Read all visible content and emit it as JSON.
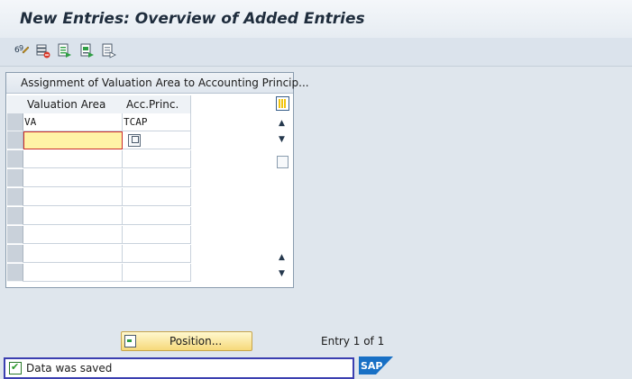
{
  "window": {
    "title": "New Entries: Overview of Added Entries"
  },
  "toolbar": {
    "buttons": [
      {
        "icon": "change-display-icon"
      },
      {
        "icon": "delete-row-icon"
      },
      {
        "icon": "select-all-icon"
      },
      {
        "icon": "select-block-icon"
      },
      {
        "icon": "deselect-all-icon"
      }
    ]
  },
  "table": {
    "title": "Assignment of Valuation Area to Accounting Princip...",
    "columns": [
      "Valuation Area",
      "Acc.Princ."
    ],
    "rows": [
      [
        "VA",
        "TCAP"
      ],
      [
        "",
        ""
      ],
      [
        "",
        ""
      ],
      [
        "",
        ""
      ],
      [
        "",
        ""
      ],
      [
        "",
        ""
      ],
      [
        "",
        ""
      ],
      [
        "",
        ""
      ],
      [
        "",
        ""
      ]
    ]
  },
  "position_button": {
    "label": "Position..."
  },
  "entry_info": "Entry 1 of 1",
  "status": {
    "message": "Data was saved",
    "icon": "success-check-icon"
  },
  "brand": {
    "logo": "sap-logo",
    "color": "#1870c5"
  }
}
